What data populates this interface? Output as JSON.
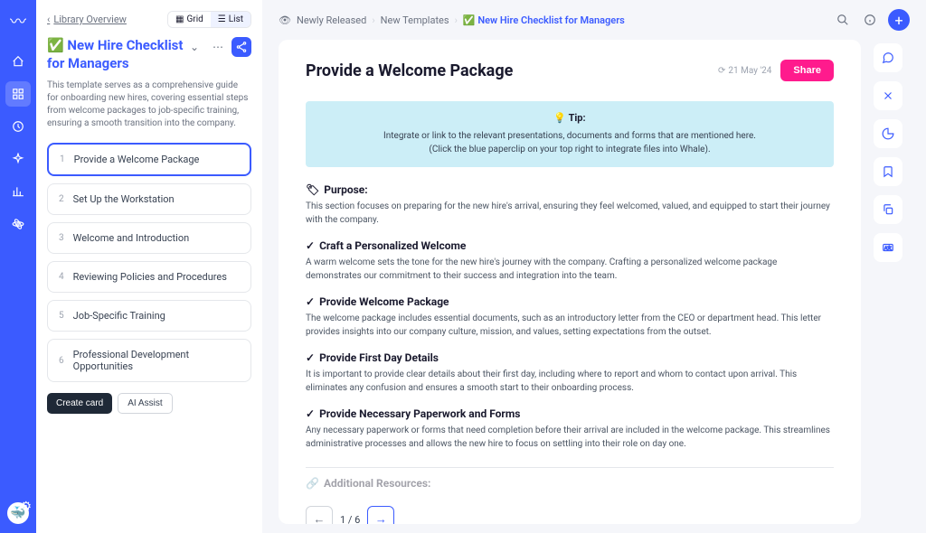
{
  "sidebar": {
    "library_link": "Library Overview",
    "view_grid": "Grid",
    "view_list": "List",
    "title": "✅ New Hire Checklist for Managers",
    "description": "This template serves as a comprehensive guide for onboarding new hires, covering essential steps from welcome packages to job-specific training, ensuring a smooth transition into the company.",
    "cards": [
      {
        "num": "1",
        "label": "Provide a Welcome Package"
      },
      {
        "num": "2",
        "label": "Set Up the Workstation"
      },
      {
        "num": "3",
        "label": "Welcome and Introduction"
      },
      {
        "num": "4",
        "label": "Reviewing Policies and Procedures"
      },
      {
        "num": "5",
        "label": "Job-Specific Training"
      },
      {
        "num": "6",
        "label": "Professional Development Opportunities"
      }
    ],
    "create_card": "Create card",
    "ai_assist": "AI Assist"
  },
  "breadcrumb": {
    "a": "Newly Released",
    "b": "New Templates",
    "c": "✅ New Hire Checklist for Managers"
  },
  "content": {
    "title": "Provide a Welcome Package",
    "timestamp": "21 May '24",
    "share": "Share",
    "tip_title": "💡 Tip:",
    "tip_text1": "Integrate or link to the relevant presentations, documents and forms that are mentioned here.",
    "tip_text2": "(Click the blue paperclip on your top right to integrate files into Whale).",
    "sections": [
      {
        "icon": "🏷",
        "head": "Purpose:",
        "body": "This section focuses on preparing for the new hire's arrival, ensuring they feel welcomed, valued, and equipped to start their journey with the company."
      },
      {
        "icon": "✓",
        "head": "Craft a Personalized Welcome",
        "body": "A warm welcome sets the tone for the new hire's journey with the company. Crafting a personalized welcome package demonstrates our commitment to their success and integration into the team."
      },
      {
        "icon": "✓",
        "head": "Provide Welcome Package",
        "body": "The welcome package includes essential documents, such as an introductory letter from the CEO or department head. This letter provides insights into our company culture, mission, and values, setting expectations from the outset."
      },
      {
        "icon": "✓",
        "head": "Provide First Day Details",
        "body": "It is important to provide clear details about their first day, including where to report and whom to contact upon arrival. This eliminates any confusion and ensures a smooth start to their onboarding process."
      },
      {
        "icon": "✓",
        "head": "Provide Necessary Paperwork and Forms",
        "body": "Any necessary paperwork or forms that need completion before their arrival are included in the welcome package. This streamlines administrative processes and allows the new hire to focus on settling into their role on day one."
      }
    ],
    "additional": "Additional Resources:",
    "pagination": "1 / 6"
  }
}
